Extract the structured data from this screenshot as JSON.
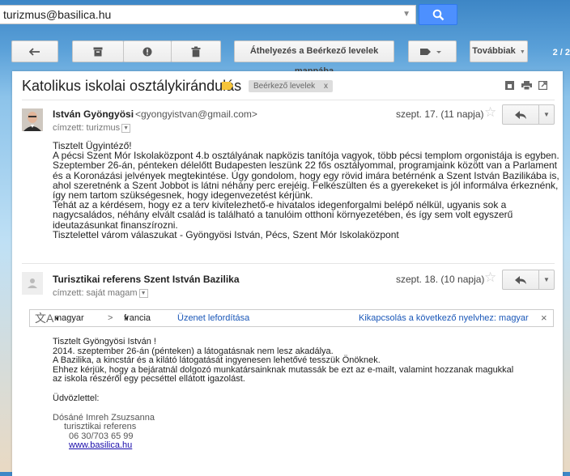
{
  "search": {
    "value": "turizmus@basilica.hu"
  },
  "toolbar": {
    "move_label": "Áthelyezés a Beérkező levelek mappába",
    "more_label": "Továbbiak",
    "pager": "2 / 2"
  },
  "thread": {
    "subject": "Katolikus iskolai osztálykirándulás",
    "label": "Beérkező levelek",
    "label_remove": "x"
  },
  "message1": {
    "sender": "István Gyöngyösi",
    "email": "<gyongyistvan@gmail.com>",
    "recipient": "címzett: turizmus",
    "date": "szept. 17. (11 napja)",
    "lines": [
      "Tisztelt Ügyintéző!",
      "A pécsi Szent Mór Iskolaközpont 4.b osztályának napközis tanítója vagyok, több pécsi templom orgonistája is egyben.",
      "Szeptember 26-án, pénteken délelőtt Budapesten leszünk 22 fős osztályommal, programjaink között van a Parlament",
      "és a Koronázási jelvények megtekintése. Úgy gondolom, hogy egy rövid imára betérnénk a Szent István Bazilikába is,",
      "ahol szeretnénk a Szent Jobbot is látni néhány perc erejéig. Felkészülten és a gyerekeket is jól informálva érkeznénk,",
      "így nem tartom szükségesnek, hogy idegenvezetést kérjünk.",
      "Tehát az a kérdésem, hogy ez a terv kivitelezhető-e hivatalos idegenforgalmi belépő nélkül, ugyanis sok a",
      "nagycsaládos, néhány elvált család is található a tanulóim otthoni környezetében, és így sem volt egyszerű",
      "ideutazásunkat finanszírozni.",
      "Tisztelettel várom válaszukat - Gyöngyösi István, Pécs, Szent Mór Iskolaközpont"
    ]
  },
  "message2": {
    "sender": "Turisztikai referens Szent István Bazilika",
    "recipient": "címzett: saját magam",
    "date": "szept. 18. (10 napja)",
    "translate": {
      "from_lang": "magyar",
      "arrow": ">",
      "to_lang": "francia",
      "translate_link": "Üzenet lefordítása",
      "disable_link": "Kikapcsolás a következő nyelvhez: magyar",
      "close": "×"
    },
    "lines": [
      "Tisztelt Gyöngyösi István !",
      "2014. szeptember 26-án (pénteken) a látogatásnak nem lesz akadálya.",
      "A Bazilika, a kincstár és a kilátó látogatását ingyenesen lehetővé tesszük Önöknek.",
      "Ehhez kérjük, hogy a bejáratnál dolgozó munkatársainknak mutassák be ezt az e-mailt, valamint hozzanak magukkal",
      "az iskola részéről egy pecséttel ellátott igazolást."
    ],
    "closing": "Üdvözlettel:",
    "signature": {
      "name": "Dósáné Imreh Zsuzsanna",
      "title": "turisztikai referens",
      "phone": "06 30/703 65 99",
      "website": "www.basilica.hu"
    }
  }
}
